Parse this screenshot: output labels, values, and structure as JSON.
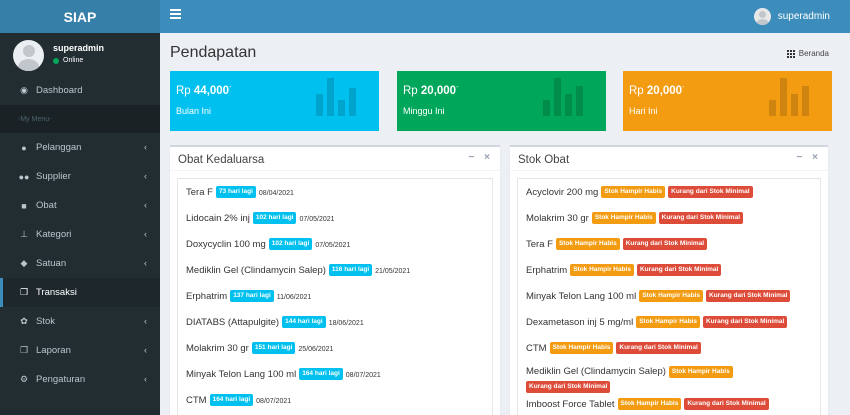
{
  "app": {
    "logo": "SIAP"
  },
  "navbar": {
    "user": "superadmin"
  },
  "sidebar": {
    "user_name": "superadmin",
    "status": "Online",
    "items": [
      {
        "label": "Dashboard",
        "icon": "dashboard-icon",
        "glyph": "◉",
        "has_chevron": false
      },
      {
        "label": "Pelanggan",
        "icon": "user-icon",
        "glyph": "●",
        "has_chevron": true
      },
      {
        "label": "Supplier",
        "icon": "users-icon",
        "glyph": "●●",
        "has_chevron": true
      },
      {
        "label": "Obat",
        "icon": "briefcase-icon",
        "glyph": "■",
        "has_chevron": true
      },
      {
        "label": "Kategori",
        "icon": "pushpin-icon",
        "glyph": "⊥",
        "has_chevron": true
      },
      {
        "label": "Satuan",
        "icon": "tag-icon",
        "glyph": "◆",
        "has_chevron": true
      },
      {
        "label": "Transaksi",
        "icon": "copy-icon",
        "glyph": "❐",
        "has_chevron": false
      },
      {
        "label": "Stok",
        "icon": "leaf-icon",
        "glyph": "✿",
        "has_chevron": true
      },
      {
        "label": "Laporan",
        "icon": "copy-icon",
        "glyph": "❐",
        "has_chevron": true
      },
      {
        "label": "Pengaturan",
        "icon": "cog-icon",
        "glyph": "⚙",
        "has_chevron": true
      }
    ],
    "header": "-My Menu-"
  },
  "page": {
    "title": "Pendapatan",
    "breadcrumb": "Beranda"
  },
  "stats": [
    {
      "currency": "Rp",
      "amount": "44,000",
      "suffix": "-",
      "label": "Bulan Ini",
      "color": "#00c0ef"
    },
    {
      "currency": "Rp",
      "amount": "20,000",
      "suffix": "-",
      "label": "Minggu Ini",
      "color": "#00a65a"
    },
    {
      "currency": "Rp",
      "amount": "20,000",
      "suffix": "-",
      "label": "Hari Ini",
      "color": "#f39c12"
    }
  ],
  "expiry_box": {
    "title": "Obat Kedaluarsa",
    "minimize": "−",
    "close": "×",
    "rows": [
      {
        "name": "Tera F",
        "badge": "73 hari lagi",
        "date": "08/04/2021"
      },
      {
        "name": "Lidocain 2% inj",
        "badge": "102 hari lagi",
        "date": "07/05/2021"
      },
      {
        "name": "Doxycyclin 100 mg",
        "badge": "102 hari lagi",
        "date": "07/05/2021"
      },
      {
        "name": "Mediklin Gel (Clindamycin Salep)",
        "badge": "116 hari lagi",
        "date": "21/05/2021"
      },
      {
        "name": "Erphatrim",
        "badge": "137 hari lagi",
        "date": "11/06/2021"
      },
      {
        "name": "DIATABS (Attapulgite)",
        "badge": "144 hari lagi",
        "date": "18/06/2021"
      },
      {
        "name": "Molakrim 30 gr",
        "badge": "151 hari lagi",
        "date": "25/06/2021"
      },
      {
        "name": "Minyak Telon Lang 100 ml",
        "badge": "164 hari lagi",
        "date": "08/07/2021"
      },
      {
        "name": "CTM",
        "badge": "164 hari lagi",
        "date": "08/07/2021"
      }
    ]
  },
  "stock_box": {
    "title": "Stok Obat",
    "minimize": "−",
    "close": "×",
    "badge_warning": "Stok Hampir Habis",
    "badge_danger": "Kurang dari Stok Minimal",
    "rows": [
      {
        "name": "Acyclovir 200 mg"
      },
      {
        "name": "Molakrim 30 gr"
      },
      {
        "name": "Tera F"
      },
      {
        "name": "Erphatrim"
      },
      {
        "name": "Minyak Telon Lang 100 ml"
      },
      {
        "name": "Dexametason inj 5 mg/ml"
      },
      {
        "name": "CTM"
      },
      {
        "name": "Mediklin Gel (Clindamycin Salep)",
        "wrap": true
      },
      {
        "name": "Imboost Force Tablet"
      }
    ]
  }
}
